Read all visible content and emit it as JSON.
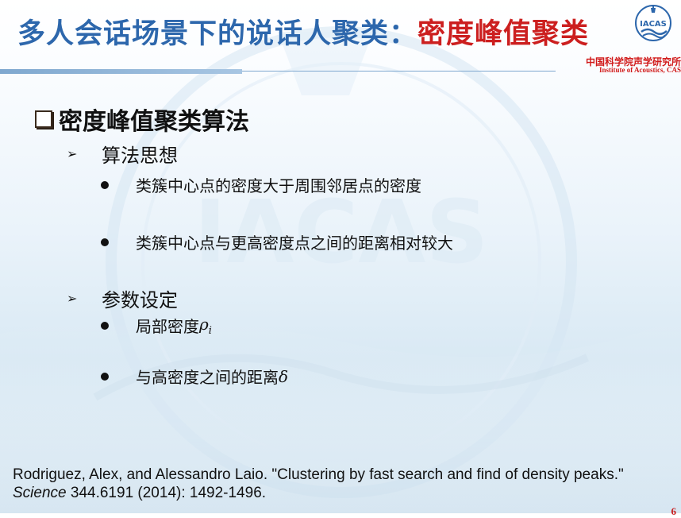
{
  "title": {
    "part1": "多人会话场景下的说话人聚类：",
    "part2": "密度峰值聚类"
  },
  "logo": {
    "badge_text": "IACAS",
    "cn_name": "中国科学院声学研究所",
    "en_name": "Institute of Acoustics, CAS"
  },
  "watermark_text": "IACAS",
  "section": {
    "title": "密度峰值聚类算法"
  },
  "items": [
    {
      "label": "算法思想",
      "bullets": [
        "类簇中心点的密度大于周围邻居点的密度",
        "类簇中心点与更高密度点之间的距离相对较大"
      ]
    },
    {
      "label": "参数设定",
      "bullets": [
        {
          "text": "局部密度",
          "math": "ρ",
          "sub": "i"
        },
        {
          "text": "与高密度之间的距离 ",
          "math": "δ"
        }
      ]
    }
  ],
  "reference": {
    "before": "Rodriguez, Alex, and Alessandro Laio. \"Clustering by fast search and find of density peaks.\" ",
    "journal": "Science",
    "after": " 344.6191 (2014): 1492-1496."
  },
  "page_number": "6",
  "colors": {
    "title_blue": "#2d67ac",
    "title_red": "#cc1f1f",
    "logo_red": "#d11a1a"
  }
}
